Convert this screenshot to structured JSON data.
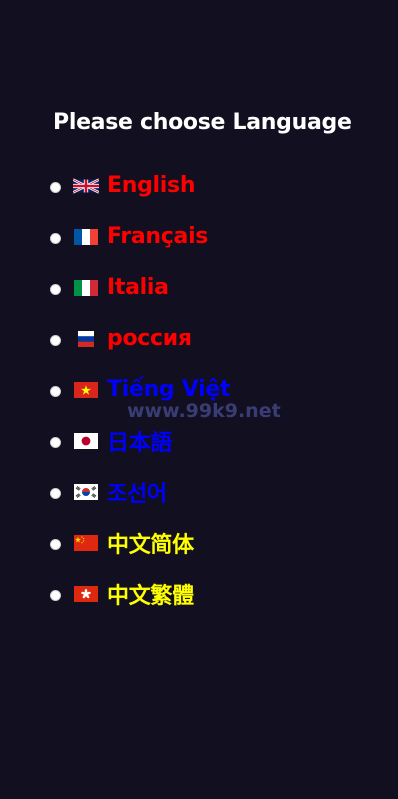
{
  "heading": "Please choose Language",
  "languages": [
    {
      "label": "English",
      "color": "#ff0000",
      "flag": "uk"
    },
    {
      "label": "Français",
      "color": "#ff0000",
      "flag": "fr"
    },
    {
      "label": "Italia",
      "color": "#ff0000",
      "flag": "it"
    },
    {
      "label": "россия",
      "color": "#ff0000",
      "flag": "ru"
    },
    {
      "label": "Tiếng Việt",
      "color": "#0000ff",
      "flag": "vn"
    },
    {
      "label": "日本語",
      "color": "#0000ff",
      "flag": "jp"
    },
    {
      "label": "조선어",
      "color": "#0000ff",
      "flag": "kr"
    },
    {
      "label": "中文简体",
      "color": "#ffff00",
      "flag": "cn"
    },
    {
      "label": "中文繁體",
      "color": "#ffff00",
      "flag": "hk"
    }
  ],
  "watermark": "www.99k9.net",
  "colors": {
    "background": "#110f20",
    "heading": "#ffffff",
    "watermark": "#3a3c74"
  }
}
